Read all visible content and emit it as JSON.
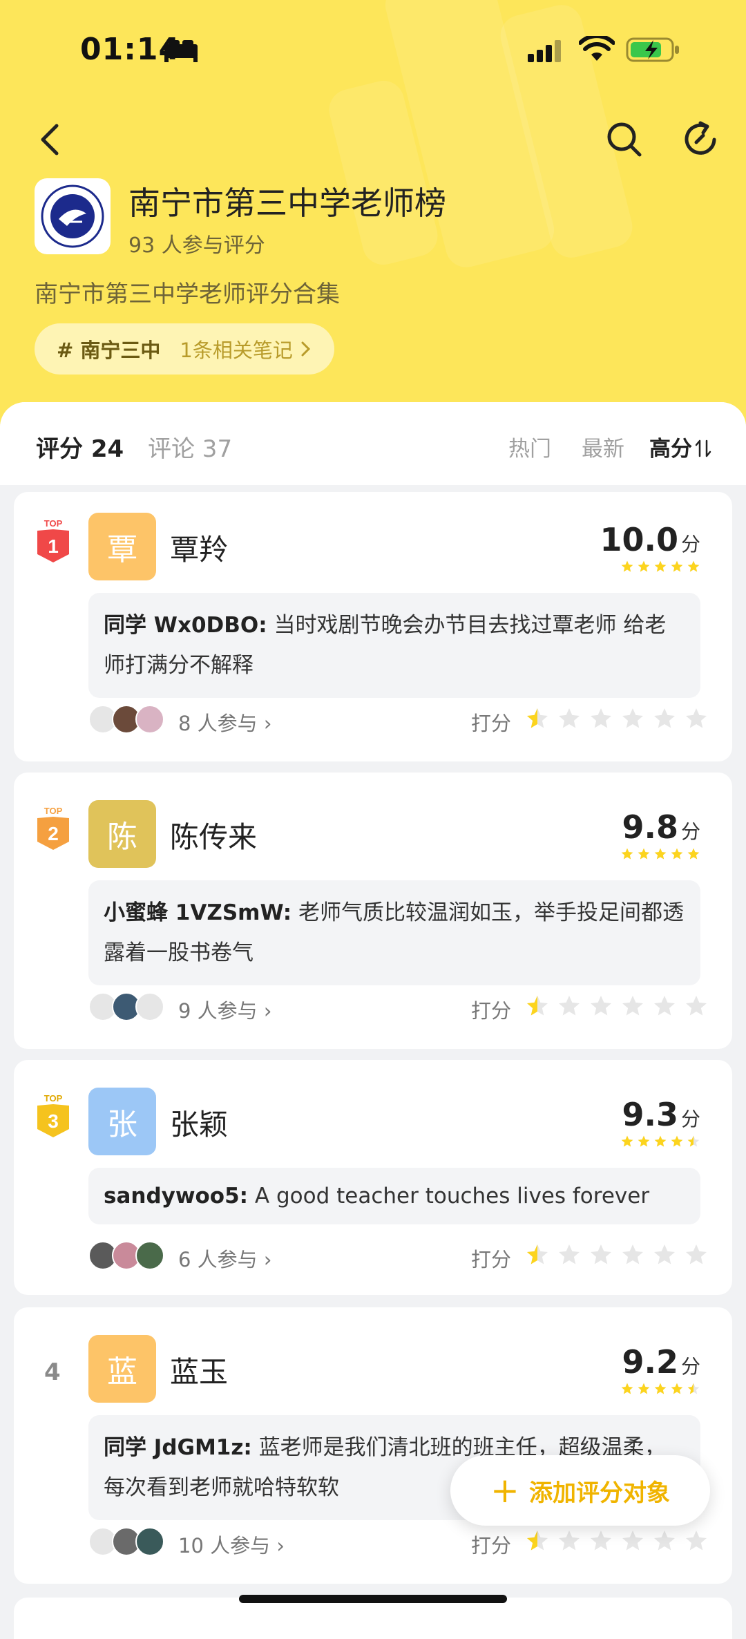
{
  "status_bar": {
    "time": "01:14"
  },
  "board": {
    "title": "南宁市第三中学老师榜",
    "participants": "93 人参与评分",
    "description": "南宁市第三中学老师评分合集",
    "topic_tag": "# 南宁三中",
    "topic_count": "1条相关笔记"
  },
  "tabs": {
    "ratings": "评分 24",
    "comments": "评论 37"
  },
  "sort": {
    "hot": "热门",
    "latest": "最新",
    "high": "高分"
  },
  "colors": {
    "accent": "#fde65a",
    "star": "#fcd41e",
    "rank1": "#f04848",
    "rank2": "#f5a040",
    "rank3": "#f5c31e"
  },
  "teachers": [
    {
      "rank_label": "1",
      "avatar_char": "覃",
      "avatar_color": "#fdc468",
      "name": "覃羚",
      "score": "10.0",
      "score_unit": "分",
      "stars": 5,
      "comment_author": "同学 Wx0DBO:",
      "comment_text": "当时戏剧节晚会办节目去找过覃老师  给老师打满分不解释",
      "join": "8 人参与",
      "rate_label": "打分"
    },
    {
      "rank_label": "2",
      "avatar_char": "陈",
      "avatar_color": "#e0c35a",
      "name": "陈传来",
      "score": "9.8",
      "score_unit": "分",
      "stars": 5,
      "comment_author": "小蜜蜂 1VZSmW:",
      "comment_text": "老师气质比较温润如玉，举手投足间都透露着一股书卷气",
      "join": "9 人参与",
      "rate_label": "打分"
    },
    {
      "rank_label": "3",
      "avatar_char": "张",
      "avatar_color": "#9cc7f6",
      "name": "张颖",
      "score": "9.3",
      "score_unit": "分",
      "stars": 4.5,
      "comment_author": "sandywoo5:",
      "comment_text": "A good teacher touches lives forever",
      "join": "6 人参与",
      "rate_label": "打分"
    },
    {
      "rank_label": "4",
      "avatar_char": "蓝",
      "avatar_color": "#fdc468",
      "name": "蓝玉",
      "score": "9.2",
      "score_unit": "分",
      "stars": 4.5,
      "comment_author": "同学 JdGM1z:",
      "comment_text": "蓝老师是我们清北班的班主任，超级温柔，每次看到老师就哈特软软",
      "join": "10 人参与",
      "rate_label": "打分"
    }
  ],
  "fab": {
    "label": "添加评分对象",
    "icon": "plus-icon"
  }
}
